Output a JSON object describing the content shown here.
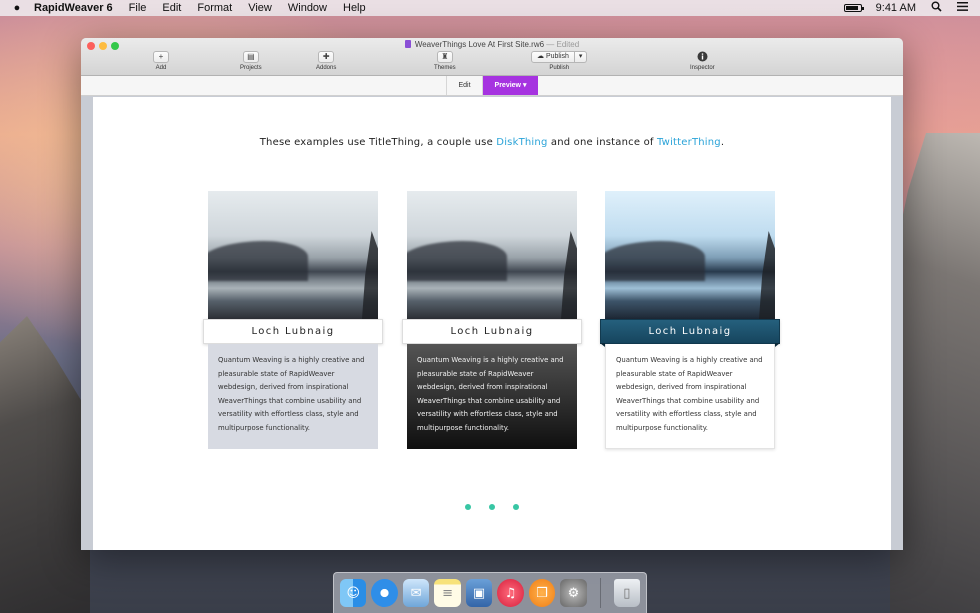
{
  "menubar": {
    "apple_icon": "apple-icon",
    "app_name": "RapidWeaver 6",
    "menus": [
      "File",
      "Edit",
      "Format",
      "View",
      "Window",
      "Help"
    ],
    "time": "9:41 AM"
  },
  "window": {
    "title": "WeaverThings Love At First Site.rw6",
    "title_status": "— Edited",
    "toolbar": {
      "add": "Add",
      "projects": "Projects",
      "addons": "Addons",
      "themes": "Themes",
      "publish_button": "Publish",
      "publish_label": "Publish",
      "inspector": "Inspector"
    },
    "modes": {
      "edit": "Edit",
      "preview": "Preview ▾"
    }
  },
  "page": {
    "intro_prefix": "These examples use TitleThing, a couple use ",
    "intro_link1": "DiskThing",
    "intro_middle": " and one instance of ",
    "intro_link2": "TwitterThing",
    "intro_suffix": ".",
    "cards": [
      {
        "title": "Loch Lubnaig",
        "text": "Quantum Weaving is a highly creative and pleasurable state of RapidWeaver webdesign, derived from inspirational WeaverThings that combine usability and versatility with effortless class, style and multipurpose functionality."
      },
      {
        "title": "Loch Lubnaig",
        "text": "Quantum Weaving is a highly creative and pleasurable state of RapidWeaver webdesign, derived from inspirational WeaverThings that combine usability and versatility with effortless class, style and multipurpose functionality."
      },
      {
        "title": "Loch Lubnaig",
        "text": "Quantum Weaving is a highly creative and pleasurable state of RapidWeaver webdesign, derived from inspirational WeaverThings that combine usability and versatility with effortless class, style and multipurpose functionality."
      }
    ]
  },
  "dock": [
    "finder-icon",
    "safari-icon",
    "mail-icon",
    "notes-icon",
    "preview-icon",
    "itunes-icon",
    "ibooks-icon",
    "system-preferences-icon",
    "trash-icon"
  ],
  "colors": {
    "accent_purple": "#a633e0",
    "link_blue": "#2aa3d8",
    "dot_teal": "#38c6a4",
    "ribbon_blue": "#1f5672"
  }
}
